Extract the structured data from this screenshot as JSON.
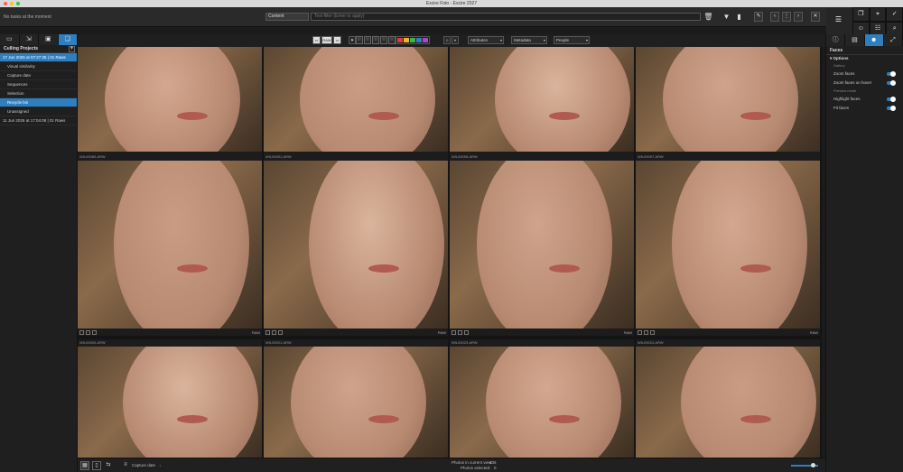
{
  "window": {
    "title": "Excire Foto - Excire 2027"
  },
  "toolbar": {
    "status": "No tasks at the moment",
    "content_select": "Content",
    "text_filter_placeholder": "Text filter (Enter to apply)"
  },
  "left_panel": {
    "header": "Culling Projects",
    "rows": [
      {
        "label": "17 Jun 2026 at 07:27:35 | 01 Raws",
        "type": "parent",
        "selected": true
      },
      {
        "label": "Visual similarity",
        "type": "child"
      },
      {
        "label": "Capture date",
        "type": "child"
      },
      {
        "label": "Sequences",
        "type": "child"
      },
      {
        "label": "Selection",
        "type": "child"
      },
      {
        "label": "Recycle bin",
        "type": "child",
        "selected": true
      },
      {
        "label": "Unassigned",
        "type": "child"
      },
      {
        "label": "11 Jun 2026 at 17:04:08 | 01 Raws",
        "type": "parent"
      }
    ]
  },
  "filter_bar": {
    "buttons": [
      "RAW"
    ],
    "dropdowns": [
      "Attributes",
      "Metadata",
      "People"
    ]
  },
  "photos": [
    {
      "filename": "",
      "raw": "RAW"
    },
    {
      "filename": "",
      "raw": "RAW"
    },
    {
      "filename": "",
      "raw": "RAW"
    },
    {
      "filename": "",
      "raw": "RAW"
    },
    {
      "filename": "WIL00089.ARW",
      "raw": "RAW"
    },
    {
      "filename": "WIL00091.ARW",
      "raw": "RAW"
    },
    {
      "filename": "WIL00095.ARW",
      "raw": "RAW"
    },
    {
      "filename": "WIL00097.ARW",
      "raw": "RAW"
    },
    {
      "filename": "WIL00000.ARW",
      "raw": "RAW"
    },
    {
      "filename": "WIL00021.ARW",
      "raw": "RAW"
    },
    {
      "filename": "WIL00023.ARW",
      "raw": "RAW"
    },
    {
      "filename": "WIL00024.ARW",
      "raw": "RAW"
    }
  ],
  "bottom_bar": {
    "sort_label": "Capture date",
    "photos_in_view_label": "Photos in current view:",
    "photos_in_view": "406",
    "photos_selected_label": "Photos selected:",
    "photos_selected": "0"
  },
  "right_panel": {
    "title": "Faces",
    "options_label": "Options",
    "gallery_label": "Gallery",
    "gallery_toggles": [
      "Zoom faces",
      "Zoom faces on hover"
    ],
    "preview_label": "Preview mode",
    "preview_toggles": [
      "Highlight faces",
      "Fit faces"
    ]
  },
  "colors": {
    "accent": "#2f7fc0",
    "labels": [
      "#e03b3b",
      "#e8b82c",
      "#3eb34a",
      "#2f7fc0",
      "#a349c9"
    ]
  }
}
